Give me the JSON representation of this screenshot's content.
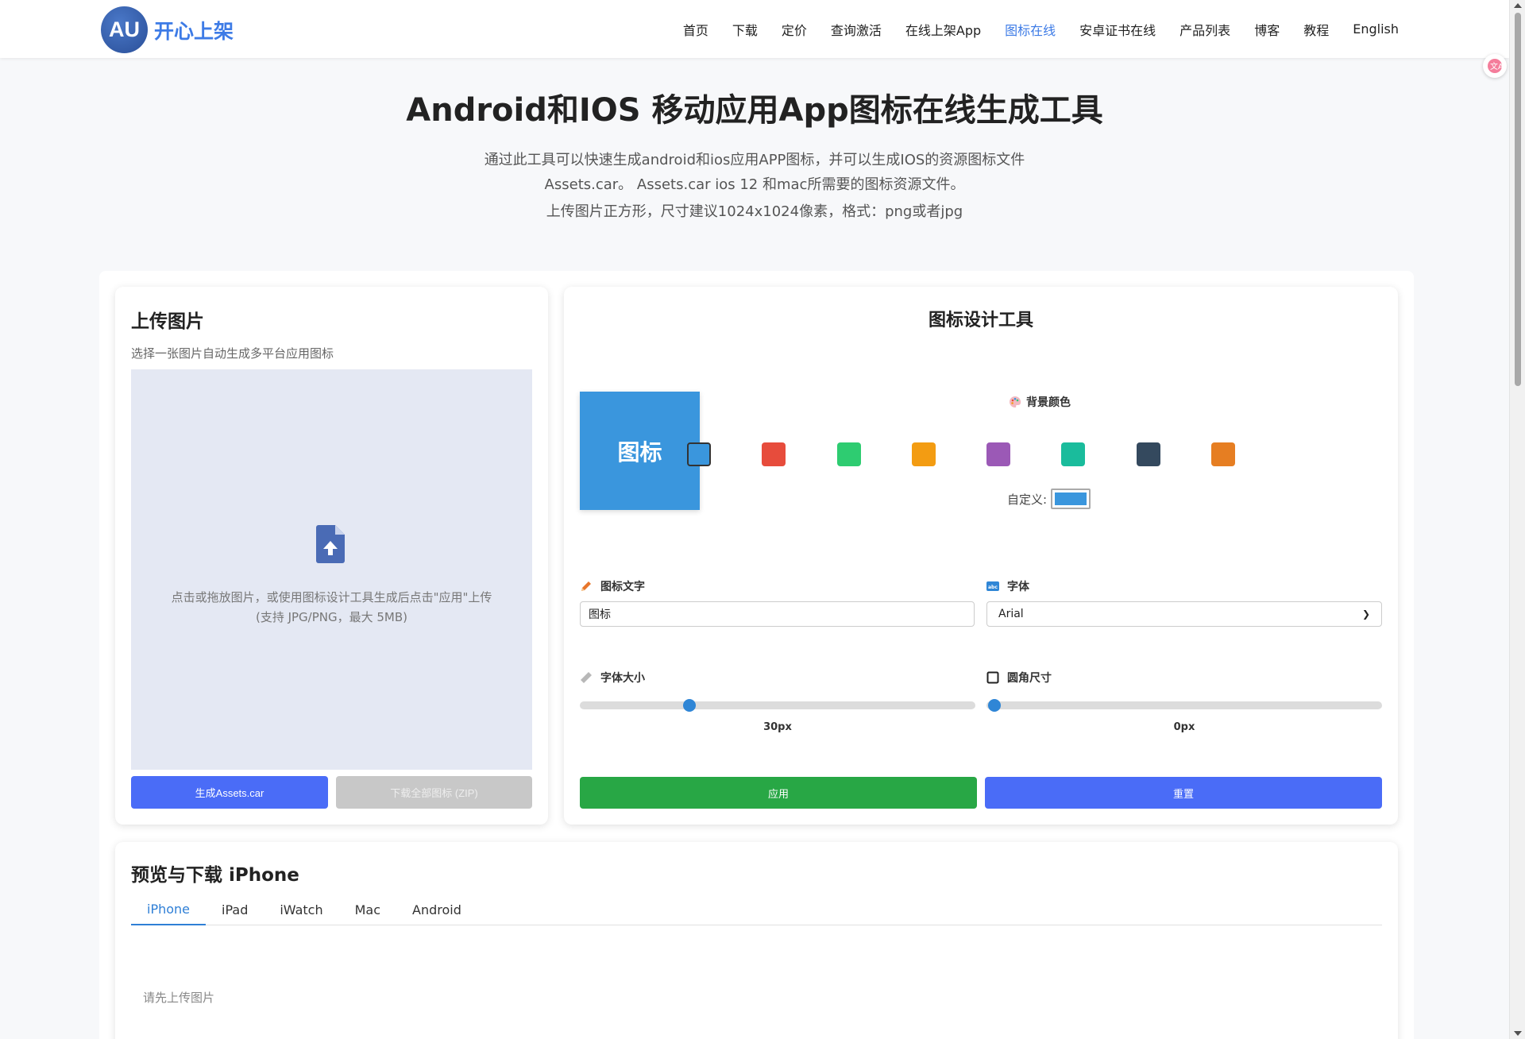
{
  "header": {
    "logo_mark": "AU",
    "logo_text": "开心上架",
    "nav": [
      {
        "label": "首页"
      },
      {
        "label": "下载"
      },
      {
        "label": "定价"
      },
      {
        "label": "查询激活"
      },
      {
        "label": "在线上架App"
      },
      {
        "label": "图标在线"
      },
      {
        "label": "安卓证书在线"
      },
      {
        "label": "产品列表"
      },
      {
        "label": "博客"
      },
      {
        "label": "教程"
      },
      {
        "label": "English"
      }
    ],
    "active_nav": "图标在线",
    "accent_color": "#3d7be6"
  },
  "hero": {
    "title": "Android和IOS 移动应用App图标在线生成工具",
    "desc": "通过此工具可以快速生成android和ios应用APP图标，并可以生成IOS的资源图标文件Assets.car。 Assets.car ios 12 和mac所需要的图标资源文件。",
    "note": "上传图片正方形，尺寸建议1024x1024像素，格式：png或者jpg"
  },
  "upload": {
    "title": "上传图片",
    "subtitle": "选择一张图片自动生成多平台应用图标",
    "drop_text_1": "点击或拖放图片，或使用图标设计工具生成后点击\"应用\"上传",
    "drop_text_2": "(支持 JPG/PNG，最大 5MB)",
    "icon": "file-upload-icon",
    "btn_generate": "生成Assets.car",
    "btn_download_zip": "下载全部图标 (ZIP)"
  },
  "design": {
    "title": "图标设计工具",
    "preview_text": "图标",
    "preview_color": "#3a96dd",
    "bg_color_label": "背景颜色",
    "swatches": [
      "#3a96dd",
      "#e74c3c",
      "#2ecc71",
      "#f39c12",
      "#9b59b6",
      "#1abc9c",
      "#34495e",
      "#e67e22"
    ],
    "selected_swatch": 0,
    "custom_label": "自定义:",
    "custom_color": "#3a96dd",
    "text_label": "图标文字",
    "text_value": "图标",
    "font_label": "字体",
    "font_value": "Arial",
    "font_size_label": "字体大小",
    "font_size_value": "30px",
    "font_size_fraction": 0.27,
    "radius_label": "圆角尺寸",
    "radius_value": "0px",
    "radius_fraction": 0.0,
    "btn_apply": "应用",
    "btn_reset": "重置"
  },
  "preview": {
    "title": "预览与下载 iPhone",
    "tabs": [
      "iPhone",
      "iPad",
      "iWatch",
      "Mac",
      "Android"
    ],
    "active_tab": 0,
    "empty_text": "请先上传图片"
  }
}
